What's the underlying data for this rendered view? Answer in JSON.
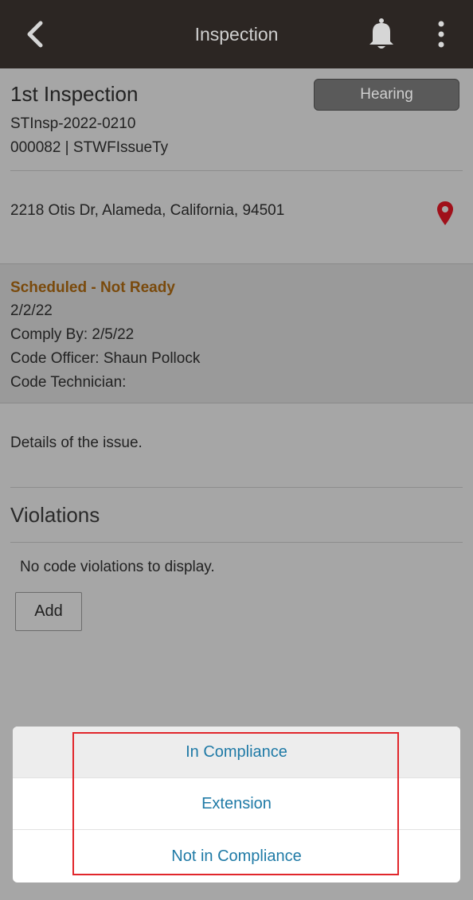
{
  "header": {
    "title": "Inspection",
    "back_icon": "chevron-left-icon",
    "bell_icon": "bell-icon",
    "more_icon": "more-vertical-icon"
  },
  "inspection": {
    "title": "1st Inspection",
    "hearing_label": "Hearing",
    "id": "STInsp-2022-0210",
    "issue": "000082 | STWFIssueTy",
    "address": "2218 Otis Dr, Alameda, California, 94501",
    "location_icon": "location-pin-icon",
    "location_icon_color": "#a0101a"
  },
  "schedule": {
    "status": "Scheduled - Not Ready",
    "status_color": "#7a4a0c",
    "date": "2/2/22",
    "comply_by": "Comply By: 2/5/22",
    "code_officer": "Code Officer: Shaun Pollock",
    "code_technician": "Code Technician:"
  },
  "details": "Details of the issue.",
  "violations": {
    "heading": "Violations",
    "empty_text": "No code violations to display.",
    "add_label": "Add"
  },
  "action_sheet": {
    "items": [
      {
        "label": "In Compliance"
      },
      {
        "label": "Extension"
      },
      {
        "label": "Not in Compliance"
      }
    ],
    "text_color": "#1f7aa6",
    "highlight_color": "#e1262b"
  }
}
